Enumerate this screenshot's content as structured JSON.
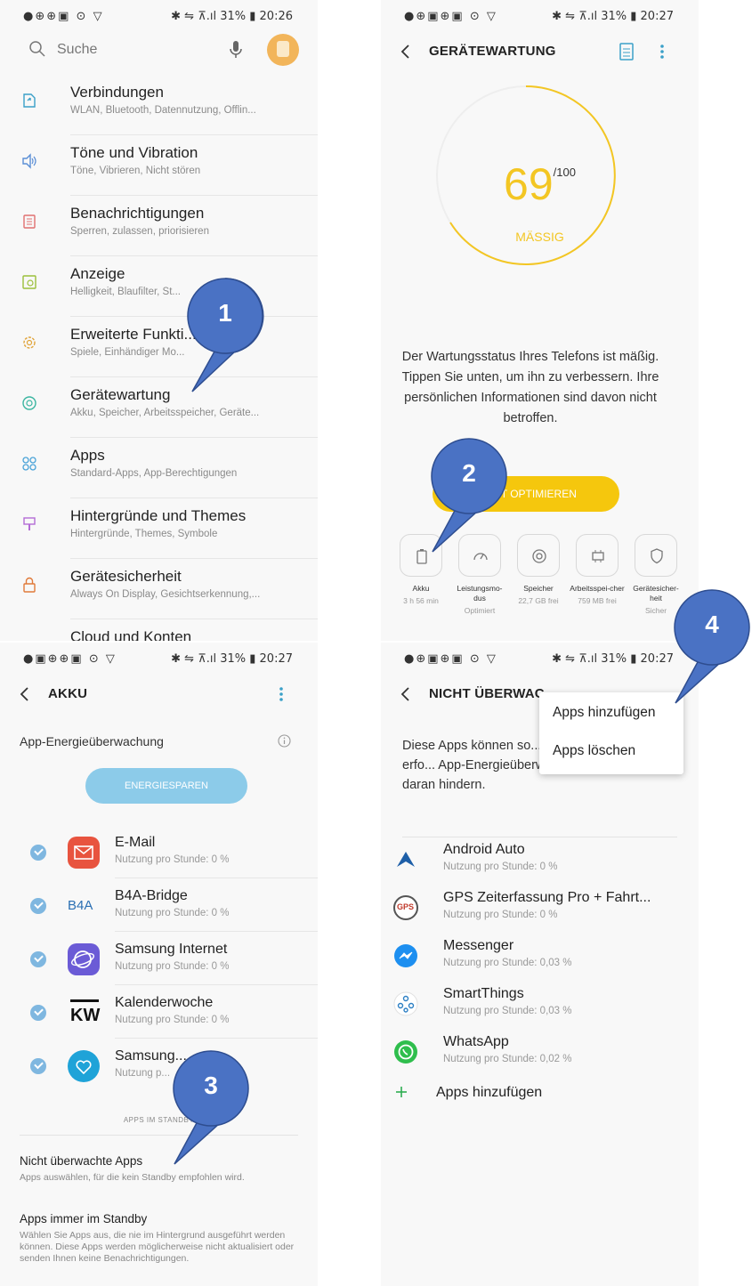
{
  "panel1": {
    "status_left": "●⊕⊕▣ ⊙ ▽",
    "status_right": "✱ ⇋ ⊼.ıl 31% ▮ 20:26",
    "search_placeholder": "Suche",
    "items": [
      {
        "title": "Verbindungen",
        "subtitle": "WLAN, Bluetooth, Datennutzung, Offlin..."
      },
      {
        "title": "Töne und Vibration",
        "subtitle": "Töne, Vibrieren, Nicht stören"
      },
      {
        "title": "Benachrichtigungen",
        "subtitle": "Sperren, zulassen, priorisieren"
      },
      {
        "title": "Anzeige",
        "subtitle": "Helligkeit, Blaufilter, St..."
      },
      {
        "title": "Erweiterte Funkti...",
        "subtitle": "Spiele, Einhändiger Mo..."
      },
      {
        "title": "Gerätewartung",
        "subtitle": "Akku, Speicher, Arbeitsspeicher, Geräte..."
      },
      {
        "title": "Apps",
        "subtitle": "Standard-Apps, App-Berechtigungen"
      },
      {
        "title": "Hintergründe und Themes",
        "subtitle": "Hintergründe, Themes, Symbole"
      },
      {
        "title": "Gerätesicherheit",
        "subtitle": "Always On Display, Gesichtserkennung,..."
      },
      {
        "title": "Cloud und Konten",
        "subtitle": ""
      }
    ]
  },
  "panel2": {
    "status_left": "●⊕▣⊕▣ ⊙ ▽",
    "status_right": "✱ ⇋ ⊼.ıl 31% ▮ 20:27",
    "title": "GERÄTEWARTUNG",
    "score": "69",
    "score_max": "/100",
    "score_status": "MÄSSIG",
    "message": "Der Wartungsstatus Ihres Telefons ist mäßig. Tippen Sie unten, um ihn zu verbessern. Ihre persönlichen Informationen sind davon nicht betroffen.",
    "optimize_label": "JETZT OPTIMIEREN",
    "categories": [
      {
        "label": "Akku",
        "value": "3 h 56 min"
      },
      {
        "label": "Leistungsmo-dus",
        "value": "Optimiert"
      },
      {
        "label": "Speicher",
        "value": "22,7 GB frei"
      },
      {
        "label": "Arbeitsspei-cher",
        "value": "759 MB frei"
      },
      {
        "label": "Gerätesicher-heit",
        "value": "Sicher"
      }
    ]
  },
  "panel3": {
    "status_left": "●▣⊕⊕▣ ⊙ ▽",
    "status_right": "✱ ⇋ ⊼.ıl 31% ▮ 20:27",
    "title": "AKKU",
    "energy_header": "App-Energieüberwachung",
    "energy_button": "ENERGIESPAREN",
    "apps": [
      {
        "name": "E-Mail",
        "usage": "Nutzung pro Stunde: 0 %",
        "icon_color": "#e8543f"
      },
      {
        "name": "B4A-Bridge",
        "usage": "Nutzung pro Stunde: 0 %",
        "icon_text": "B4A"
      },
      {
        "name": "Samsung Internet",
        "usage": "Nutzung pro Stunde: 0 %",
        "icon_color": "#6b5bd6"
      },
      {
        "name": "Kalenderwoche",
        "usage": "Nutzung pro Stunde: 0 %",
        "icon_text": "KW"
      },
      {
        "name": "Samsung...",
        "usage": "Nutzung p...",
        "icon_color": "#1fa3d8"
      }
    ],
    "standby_label": "APPS IM STANDBY",
    "unmonitored_title": "Nicht überwachte Apps",
    "unmonitored_sub": "Apps auswählen, für die kein Standby empfohlen wird.",
    "always_title": "Apps immer im Standby",
    "always_sub": "Wählen Sie Apps aus, die nie im Hintergrund ausgeführt werden können. Diese Apps werden möglicherweise nicht aktualisiert oder senden Ihnen keine Benachrichtigungen."
  },
  "panel4": {
    "status_left": "●⊕▣⊕▣ ⊙ ▽",
    "status_right": "✱ ⇋ ⊼.ıl 31% ▮ 20:27",
    "title": "NICHT ÜBERWAC...",
    "text": "Diese Apps können so... verbrauchen, wie erfo... App-Energieüberwachung wird sie nicht daran hindern.",
    "menu": [
      "Apps hinzufügen",
      "Apps löschen"
    ],
    "apps": [
      {
        "name": "Android Auto",
        "usage": "Nutzung pro Stunde: 0 %",
        "icon_color": "#1e5fa8"
      },
      {
        "name": "GPS Zeiterfassung Pro + Fahrt...",
        "usage": "Nutzung pro Stunde: 0 %",
        "icon_text": "GPS"
      },
      {
        "name": "Messenger",
        "usage": "Nutzung pro Stunde: 0,03 %",
        "icon_color": "#1d8ff0"
      },
      {
        "name": "SmartThings",
        "usage": "Nutzung pro Stunde: 0,03 %",
        "icon_color": "#2c7fc4"
      },
      {
        "name": "WhatsApp",
        "usage": "Nutzung pro Stunde: 0,02 %",
        "icon_color": "#2fbe4d"
      }
    ],
    "add_label": "Apps hinzufügen"
  },
  "callouts": [
    "1",
    "2",
    "3",
    "4"
  ],
  "colors": {
    "callout": "#4a72c4",
    "callout_border": "#2e4d8f",
    "accent_yellow": "#f3c623",
    "check_blue": "#7fb7e0"
  }
}
